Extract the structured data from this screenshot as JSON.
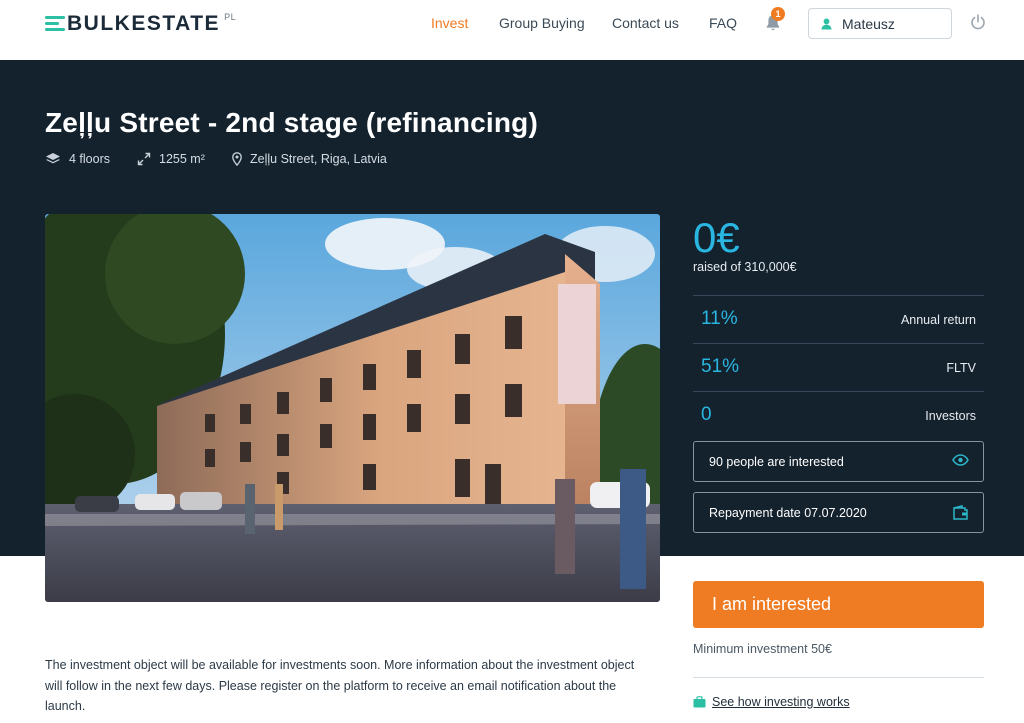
{
  "header": {
    "logo_text": "BULKESTATE",
    "logo_sup": "PL",
    "nav": [
      {
        "label": "Invest",
        "active": true
      },
      {
        "label": "Group Buying",
        "active": false
      },
      {
        "label": "Contact us",
        "active": false
      },
      {
        "label": "FAQ",
        "active": false
      }
    ],
    "notification_count": "1",
    "user_name": "Mateusz",
    "icons": [
      "bell-icon",
      "user-icon",
      "power-icon"
    ]
  },
  "project": {
    "title": "Zeļļu Street - 2nd stage (refinancing)",
    "floors": "4 floors",
    "area": "1255 m²",
    "location": "Zeļļu Street, Riga, Latvia"
  },
  "stats": {
    "raised": "0€",
    "raised_label": "raised of 310,000€",
    "rows": [
      {
        "value": "11%",
        "label": "Annual return"
      },
      {
        "value": "51%",
        "label": "FLTV"
      },
      {
        "value": "0",
        "label": "Investors"
      }
    ],
    "interested": "90 people are interested",
    "repayment": "Repayment date 07.07.2020"
  },
  "cta": {
    "button": "I am interested",
    "min_investment": "Minimum investment 50€",
    "how_link": "See how investing works"
  },
  "description": "The investment object will be available for investments soon. More information about the investment object will follow in the next few days. Please register on the platform to receive an email notification about the launch.",
  "colors": {
    "accent": "#ef7b22",
    "highlight": "#29b6e0",
    "brand": "#2bbfa3",
    "hero_bg": "#14222e"
  }
}
